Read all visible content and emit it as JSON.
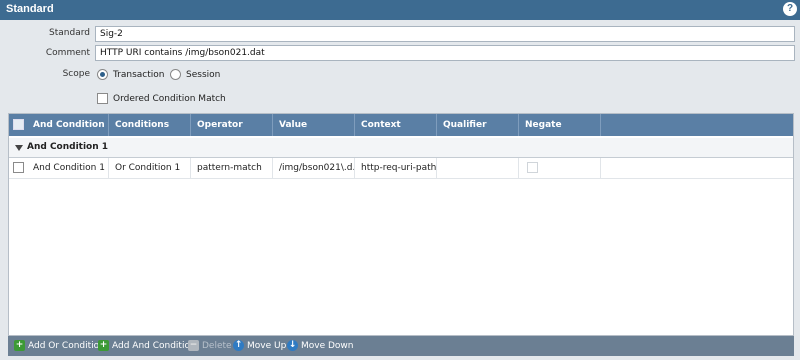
{
  "window": {
    "title": "Standard"
  },
  "form": {
    "standard_label": "Standard",
    "standard_value": "Sig-2",
    "comment_label": "Comment",
    "comment_value": "HTTP URI contains /img/bson021.dat",
    "scope_label": "Scope",
    "scope_options": [
      {
        "label": "Transaction",
        "selected": true
      },
      {
        "label": "Session",
        "selected": false
      }
    ],
    "ordered_label": "Ordered Condition Match",
    "ordered_checked": false
  },
  "grid": {
    "columns": [
      "And Condition",
      "Conditions",
      "Operator",
      "Value",
      "Context",
      "Qualifier",
      "Negate"
    ],
    "group": {
      "label": "And Condition 1",
      "expanded": true
    },
    "rows": [
      {
        "and_condition": "And Condition 1",
        "conditions": "Or Condition 1",
        "operator": "pattern-match",
        "value": "/img/bson021\\.d...",
        "context": "http-req-uri-path",
        "qualifier": "",
        "negate": false
      }
    ]
  },
  "toolbar": {
    "add_or": "Add Or Condition",
    "add_and": "Add And Condition",
    "delete": "Delete",
    "move_up": "Move Up",
    "move_down": "Move Down"
  },
  "icons": {
    "help": "help-icon",
    "add": "plus-icon",
    "delete": "minus-icon",
    "up": "arrow-up-icon",
    "down": "arrow-down-icon"
  },
  "colors": {
    "titlebar": "#3d6b91",
    "grid_header": "#5a7fa5",
    "toolbar": "#6b7f93"
  }
}
